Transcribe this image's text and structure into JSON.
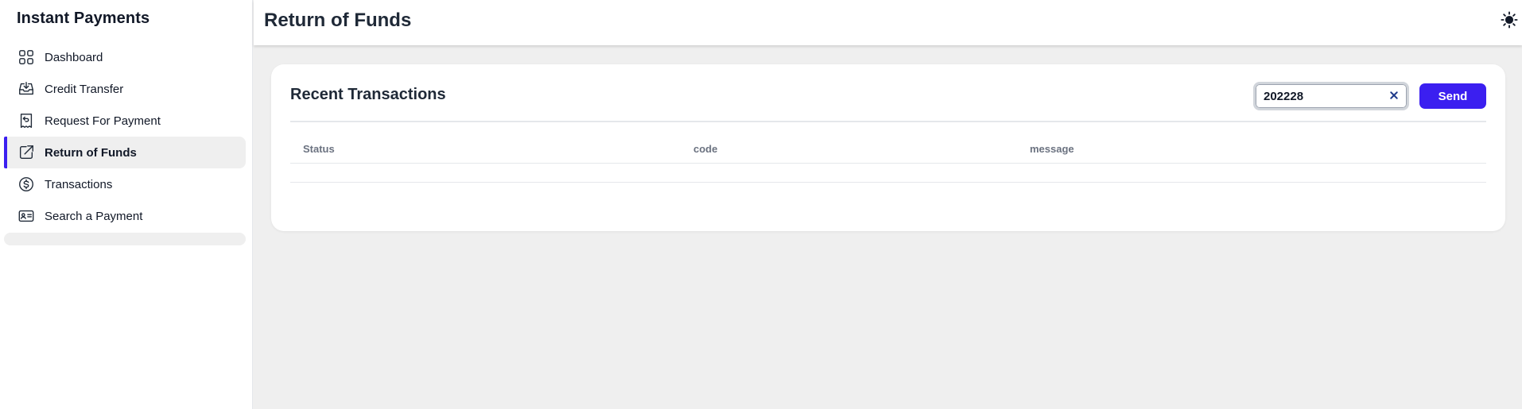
{
  "app": {
    "title": "Instant Payments"
  },
  "sidebar": {
    "items": [
      {
        "label": "Dashboard",
        "icon": "dashboard-grid-icon",
        "active": false
      },
      {
        "label": "Credit Transfer",
        "icon": "inbox-download-icon",
        "active": false
      },
      {
        "label": "Request For Payment",
        "icon": "receipt-refund-icon",
        "active": false
      },
      {
        "label": "Return of Funds",
        "icon": "external-link-icon",
        "active": true
      },
      {
        "label": "Transactions",
        "icon": "dollar-circle-icon",
        "active": false
      },
      {
        "label": "Search a Payment",
        "icon": "id-card-icon",
        "active": false
      }
    ]
  },
  "header": {
    "title": "Return of Funds",
    "theme_icon": "sun-icon"
  },
  "card": {
    "title": "Recent Transactions",
    "search_value": "202228",
    "clear_icon": "close-icon",
    "send_label": "Send"
  },
  "table": {
    "columns": [
      "Status",
      "code",
      "message"
    ],
    "rows": []
  },
  "colors": {
    "accent": "#3b1ff0",
    "background": "#efefef"
  }
}
